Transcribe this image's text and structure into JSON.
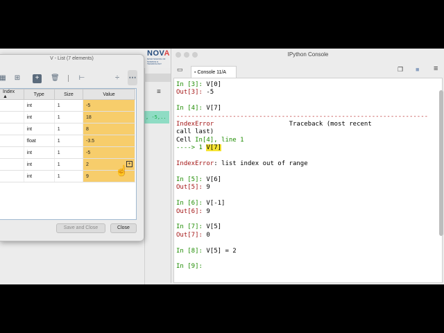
{
  "background": {
    "teal_snippet": ", -5,..",
    "hamburger": "≡"
  },
  "logo": {
    "word_pre": "NOV",
    "word_a": "A",
    "sub": "NOVA SCHOOL OF SCIENCE & TECHNOLOGY"
  },
  "dialog": {
    "title": "V - List (7 elements)",
    "columns": [
      "Index",
      "Type",
      "Size",
      "Value"
    ],
    "rows": [
      {
        "type": "int",
        "size": "1",
        "value": "-5"
      },
      {
        "type": "int",
        "size": "1",
        "value": "18"
      },
      {
        "type": "int",
        "size": "1",
        "value": "8"
      },
      {
        "type": "float",
        "size": "1",
        "value": "-3.5"
      },
      {
        "type": "int",
        "size": "1",
        "value": "-5"
      },
      {
        "type": "int",
        "size": "1",
        "value": "2"
      },
      {
        "type": "int",
        "size": "1",
        "value": "9"
      }
    ],
    "save_close_label": "Save and Close",
    "close_label": "Close",
    "icons": [
      "table-icon",
      "insert-row-icon",
      "add-icon",
      "delete-icon",
      "tree-icon",
      "resize-columns-icon",
      "more-icon"
    ]
  },
  "console": {
    "window_title": "IPython Console",
    "tab_label": "Console 11/A",
    "lines": {
      "l1_prompt": "In [3]: ",
      "l1_code": "V[0]",
      "l2_prompt": "Out[3]: ",
      "l2_val": "-5",
      "l3_prompt": "In [4]: ",
      "l3_code": "V[7]",
      "sep": "-------------------------------------------------------------------",
      "err_name": "IndexError",
      "traceback": "Traceback (most recent",
      "call_last": "call last)",
      "cell_pre": "Cell ",
      "cell_ref": "In[4], line 1",
      "arrow": "----> 1 ",
      "arrow_code": "V[7]",
      "err_msg_name": "IndexError",
      "err_msg": ": list index out of range",
      "l5_prompt": "In [5]: ",
      "l5_code": "V[6]",
      "o5_prompt": "Out[5]: ",
      "o5_val": "9",
      "l6_prompt": "In [6]: ",
      "l6_code": "V[-1]",
      "o6_prompt": "Out[6]: ",
      "o6_val": "9",
      "l7_prompt": "In [7]: ",
      "l7_code": "V[5]",
      "o7_prompt": "Out[7]: ",
      "o7_val": "0",
      "l8_prompt": "In [8]: ",
      "l8_code": "V[5] = 2",
      "l9_prompt": "In [9]: "
    }
  }
}
